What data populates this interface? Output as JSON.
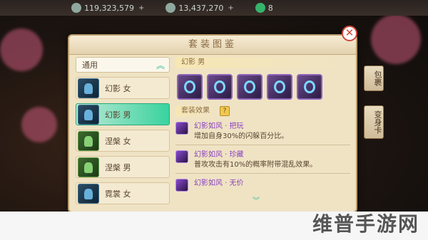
{
  "hud": {
    "silver": "119,323,579",
    "gold": "13,437,270",
    "jade": "8"
  },
  "side_tabs": [
    "包裹",
    "变身卡"
  ],
  "panel": {
    "title": "套装图鉴",
    "close_symbol": "✕"
  },
  "filter": {
    "label": "通用",
    "arrow": "︽"
  },
  "sets": [
    {
      "name": "幻影 女",
      "thumb": "blue",
      "active": false
    },
    {
      "name": "幻影 男",
      "thumb": "blue",
      "active": true
    },
    {
      "name": "涅槃 女",
      "thumb": "green",
      "active": false
    },
    {
      "name": "涅槃 男",
      "thumb": "green",
      "active": false
    },
    {
      "name": "霓裳 女",
      "thumb": "blue",
      "active": false
    }
  ],
  "detail": {
    "set_title": "幻影 男",
    "attr_title": "套装效果",
    "help_symbol": "?",
    "effects": [
      {
        "name": "幻影如风 · 把玩",
        "desc": "增加自身30%的闪躲百分比。"
      },
      {
        "name": "幻影如风 · 珍藏",
        "desc": "普攻攻击有10%的概率附带混乱效果。"
      },
      {
        "name": "幻影如风 · 无价",
        "desc": ""
      }
    ],
    "scroll_symbol": "︾"
  },
  "watermark": "维普手游网",
  "colors": {
    "active_item": "#39d39f",
    "effect_name": "#8a3fc2",
    "close_red": "#d04a3a",
    "panel_bg": "#efe3c4"
  }
}
